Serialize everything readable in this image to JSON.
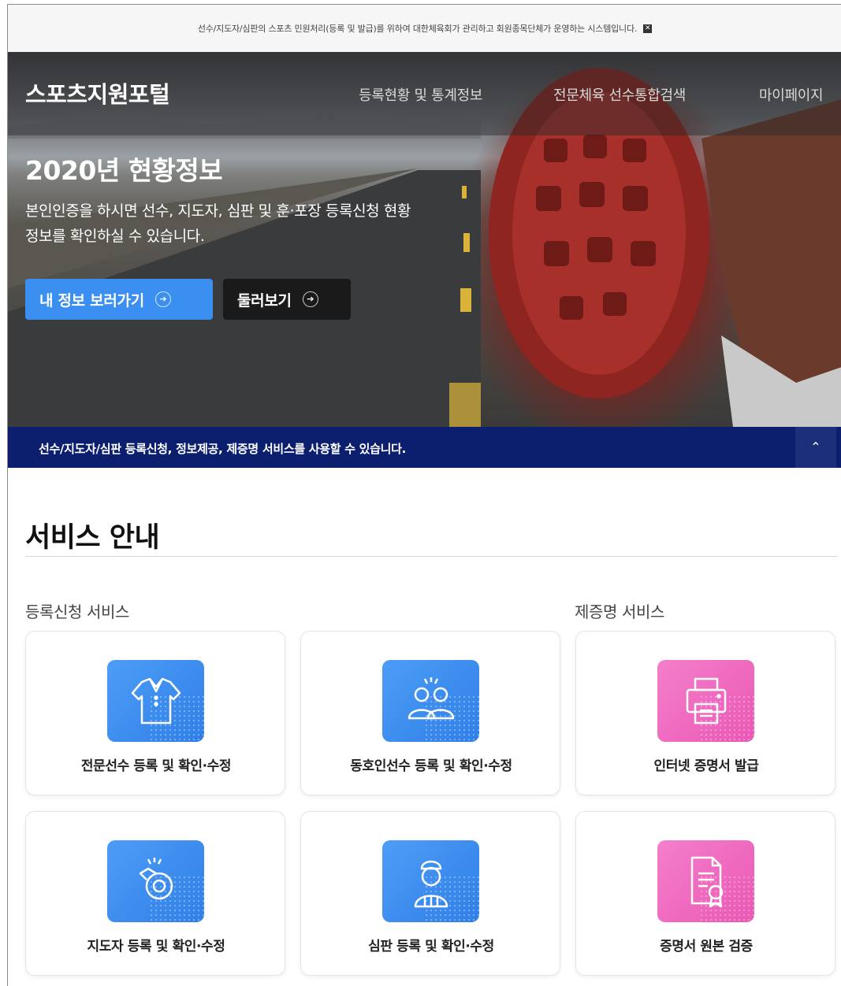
{
  "notice": {
    "text": "선수/지도자/심판의 스포츠 민원처리(등록 및 발급)를 위하여 대한체육회가 관리하고 회원종목단체가 운영하는 시스템입니다.",
    "close_icon": "close-icon"
  },
  "header": {
    "logo": "스포츠지원포털",
    "nav": [
      "등록현황 및 통계정보",
      "전문체육 선수통합검색",
      "마이페이지"
    ]
  },
  "hero": {
    "title": "2020년 현황정보",
    "desc_line1": "본인인증을 하시면 선수, 지도자, 심판 및 훈·포장 등록신청 현황",
    "desc_line2": "정보를 확인하실 수 있습니다.",
    "btn_primary": "내 정보 보러가기",
    "btn_secondary": "둘러보기",
    "btn_arrow": "➔"
  },
  "strip": {
    "text": "선수/지도자/심판 등록신청, 정보제공, 제증명 서비스를 사용할 수 있습니다.",
    "toggle": "⌃"
  },
  "services": {
    "title": "서비스 안내",
    "group_registration": "등록신청 서비스",
    "group_certificate": "제증명 서비스",
    "cards": [
      {
        "label": "전문선수 등록 및 확인·수정",
        "icon": "uniform-icon",
        "color": "#3a8ff0"
      },
      {
        "label": "동호인선수 등록 및 확인·수정",
        "icon": "people-icon",
        "color": "#3a8ff0"
      },
      {
        "label": "인터넷 증명서 발급",
        "icon": "printer-icon",
        "color": "#ee65bd"
      },
      {
        "label": "지도자 등록 및 확인·수정",
        "icon": "whistle-icon",
        "color": "#3a8ff0"
      },
      {
        "label": "심판 등록 및 확인·수정",
        "icon": "referee-icon",
        "color": "#3a8ff0"
      },
      {
        "label": "증명서 원본 검증",
        "icon": "certificate-icon",
        "color": "#ee65bd"
      }
    ]
  }
}
